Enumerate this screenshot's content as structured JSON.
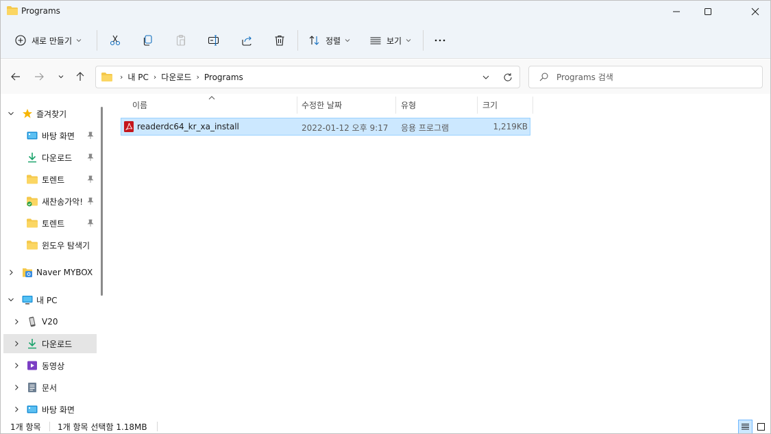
{
  "window": {
    "title": "Programs",
    "controls": [
      "minimize",
      "maximize",
      "close"
    ]
  },
  "toolbar": {
    "new_label": "새로 만들기",
    "sort_label": "정렬",
    "view_label": "보기",
    "icons": [
      "cut-icon",
      "copy-icon",
      "paste-icon",
      "rename-icon",
      "share-icon",
      "delete-icon",
      "more-icon"
    ]
  },
  "address": {
    "crumbs": [
      "내 PC",
      "다운로드",
      "Programs"
    ]
  },
  "search": {
    "placeholder": "Programs 검색"
  },
  "sidebar": {
    "quick_access_label": "즐겨찾기",
    "quick_access_items": [
      {
        "label": "바탕 화면",
        "icon": "desktop-icon",
        "pinned": true
      },
      {
        "label": "다운로드",
        "icon": "download-icon",
        "pinned": true
      },
      {
        "label": "토렌트",
        "icon": "folder-icon",
        "pinned": true
      },
      {
        "label": "새찬송가악!",
        "icon": "folder-synced-icon",
        "pinned": true
      },
      {
        "label": "토렌트",
        "icon": "folder-icon",
        "pinned": true
      },
      {
        "label": "윈도우 탐색기",
        "icon": "folder-icon",
        "pinned": false
      }
    ],
    "mybox_label": "Naver MYBOX",
    "thispc_label": "내 PC",
    "thispc_items": [
      {
        "label": "V20",
        "icon": "phone-icon"
      },
      {
        "label": "다운로드",
        "icon": "download-icon"
      },
      {
        "label": "동영상",
        "icon": "video-icon"
      },
      {
        "label": "문서",
        "icon": "document-icon"
      },
      {
        "label": "바탕 화면",
        "icon": "desktop-icon"
      }
    ]
  },
  "columns": {
    "name": "이름",
    "date": "수정한 날짜",
    "type": "유형",
    "size": "크기"
  },
  "files": [
    {
      "name": "readerdc64_kr_xa_install",
      "date": "2022-01-12 오후 9:17",
      "type": "응용 프로그램",
      "size": "1,219KB",
      "icon": "pdf-app-icon",
      "selected": true
    }
  ],
  "status": {
    "item_count": "1개 항목",
    "selection": "1개 항목 선택함 1.18MB"
  },
  "colors": {
    "titlebar": "#eff4f9",
    "selection": "#cce8ff",
    "selection_border": "#99d1ff",
    "folder": "#f4c84b",
    "download": "#1aa36b",
    "pdf_red": "#c4161c"
  }
}
